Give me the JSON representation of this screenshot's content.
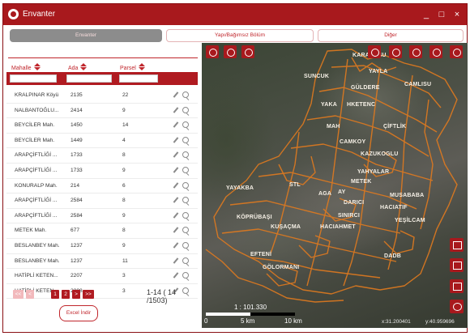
{
  "window": {
    "title": "Envanter",
    "controls": [
      "_",
      "□",
      "×"
    ]
  },
  "tabs": [
    {
      "label": "Envanter",
      "active": true
    },
    {
      "label": "Yapı/Bağımsız Bölüm",
      "active": false
    },
    {
      "label": "Diğer",
      "active": false
    }
  ],
  "table": {
    "columns": [
      "Mahalle",
      "Ada",
      "Parsel"
    ],
    "filters": [
      "",
      "",
      ""
    ],
    "rows": [
      [
        "KRALPINAR Köyü",
        "2135",
        "22"
      ],
      [
        "NALBANTOĞLU...",
        "2414",
        "9"
      ],
      [
        "BEYCİLER Mah.",
        "1450",
        "14"
      ],
      [
        "BEYCİLER Mah.",
        "1449",
        "4"
      ],
      [
        "ARAPÇİFTLİĞİ ...",
        "1733",
        "8"
      ],
      [
        "ARAPÇİFTLİĞİ ...",
        "1733",
        "9"
      ],
      [
        "KONURALP Mah.",
        "214",
        "6"
      ],
      [
        "ARAPÇİFTLİĞİ ...",
        "2584",
        "8"
      ],
      [
        "ARAPÇİFTLİĞİ ...",
        "2584",
        "9"
      ],
      [
        "METEK Mah.",
        "677",
        "8"
      ],
      [
        "BESLANBEY Mah.",
        "1237",
        "9"
      ],
      [
        "BESLANBEY Mah.",
        "1237",
        "11"
      ],
      [
        "HATİPLİ KETEN...",
        "2207",
        "3"
      ],
      [
        "HATİPLİ KETEN...",
        "2208",
        "3"
      ]
    ]
  },
  "pager": {
    "first": "<<",
    "prev": "<",
    "pages": [
      "1",
      "2"
    ],
    "current_page": "1",
    "next": ">",
    "last": ">>",
    "range_text": "1-14 ( 14 /1503)"
  },
  "excel_button": "Excel İndir",
  "map": {
    "scale_text": "1 : 101.330",
    "scale_labels": [
      "0",
      "5 km",
      "10 km"
    ],
    "coord_x": "x:31.200401",
    "coord_y": "y:40.959696",
    "place_names": [
      "KARACASU",
      "SUNCUK",
      "YAYLA",
      "GÜLDERE",
      "CAMLISU",
      "YAKA",
      "HKETENC",
      "MAH",
      "ÇİFTLİK",
      "CAMKOY",
      "KAZUKOGLU",
      "YAHYALAR",
      "METEK",
      "YAYAKBA",
      "STL",
      "AGA",
      "AY",
      "MUSABABA",
      "DARICI",
      "HACIATIF",
      "KÖPRÜBAŞI",
      "SINIRCI",
      "YEŞİLCAM",
      "KUŞAÇMA",
      "HACIAHMET",
      "EFTENİ",
      "DADB",
      "GÖLORMANI"
    ],
    "top_tools": [
      "location-pin-icon",
      "search-area-icon",
      "globe-icon",
      "hierarchy-icon",
      "pipe-icon",
      "layers-icon",
      "tower-icon",
      "frame-icon"
    ],
    "side_tools": [
      "image-icon",
      "home-icon",
      "zoom-extent-icon",
      "info-icon"
    ]
  },
  "colors": {
    "accent": "#a8191d",
    "map_overlay": "#e07a1f"
  }
}
